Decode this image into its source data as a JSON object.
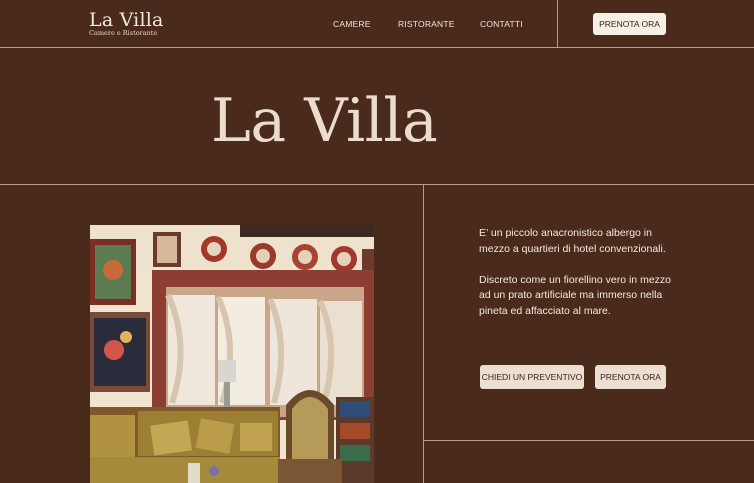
{
  "brand": {
    "name": "La Villa",
    "tagline": "Camere e Ristorante"
  },
  "nav": {
    "items": [
      "CAMERE",
      "RISTORANTE",
      "CONTATTI"
    ],
    "cta": "PRENOTA ORA"
  },
  "hero": {
    "title": "La Villa"
  },
  "intro": {
    "paragraphs": [
      "E’ un piccolo anacronistico albergo in mezzo a quartieri di hotel convenzionali.",
      "Discreto come un fiorellino vero in mezzo ad un prato artificiale ma immerso nella pineta ed affacciato al mare."
    ]
  },
  "actions": {
    "quote": "CHIEDI UN PREVENTIVO",
    "book": "PRENOTA ORA"
  },
  "colors": {
    "background": "#4a2a1a",
    "line": "#b79b86",
    "button_bg": "#ecdfd2",
    "button_text": "#3b2317",
    "text": "#f2e6da"
  }
}
